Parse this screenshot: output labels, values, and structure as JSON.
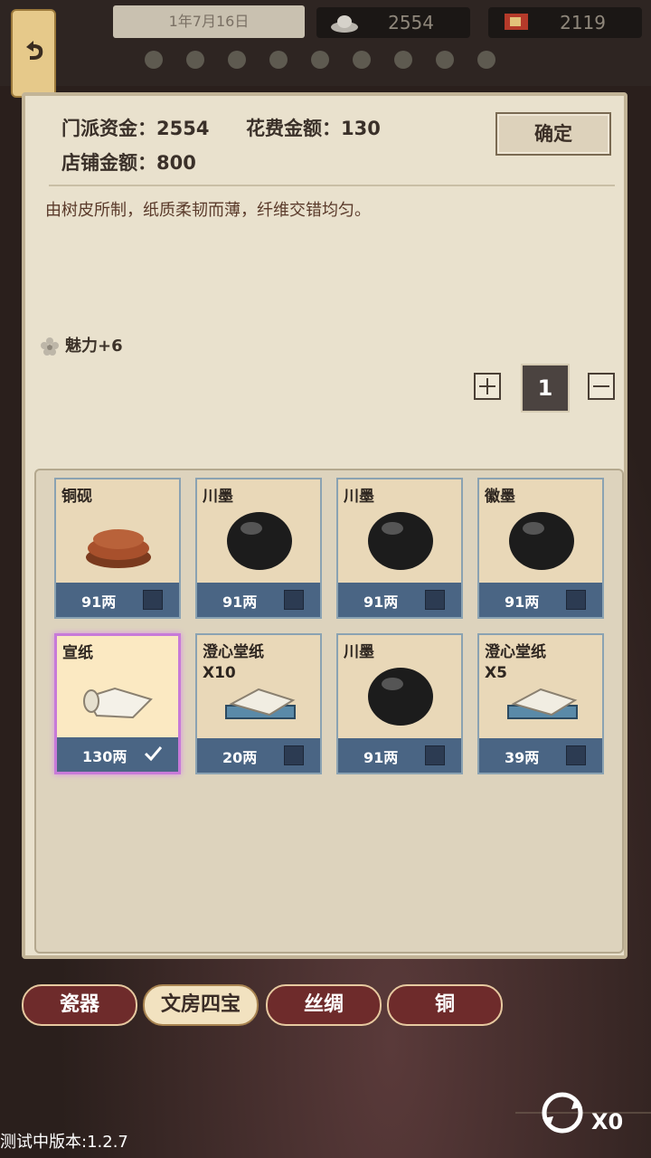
{
  "topbar": {
    "date": "1年7月16日",
    "silver": "2554",
    "flag": "2119"
  },
  "panel": {
    "fund_label": "门派资金：2554",
    "cost_label": "花费金额：130",
    "shop_label": "店铺金额：800",
    "confirm_label": "确定",
    "description": "由树皮所制，纸质柔韧而薄，纤维交错均匀。",
    "attribute": "魅力+6",
    "quantity": "1"
  },
  "items": [
    {
      "name": "铜砚",
      "count": "",
      "price": "91两",
      "icon": "inkstone-icon",
      "selected": false
    },
    {
      "name": "川墨",
      "count": "",
      "price": "91两",
      "icon": "ink-stick-icon",
      "selected": false
    },
    {
      "name": "川墨",
      "count": "",
      "price": "91两",
      "icon": "ink-stick-icon",
      "selected": false
    },
    {
      "name": "徽墨",
      "count": "",
      "price": "91两",
      "icon": "ink-stick-icon",
      "selected": false
    },
    {
      "name": "宣纸",
      "count": "",
      "price": "130两",
      "icon": "paper-scroll-icon",
      "selected": true
    },
    {
      "name": "澄心堂纸",
      "count": "X10",
      "price": "20两",
      "icon": "paper-bundle-icon",
      "selected": false
    },
    {
      "name": "川墨",
      "count": "",
      "price": "91两",
      "icon": "ink-stick-icon",
      "selected": false
    },
    {
      "name": "澄心堂纸",
      "count": "X5",
      "price": "39两",
      "icon": "paper-bundle-icon",
      "selected": false
    }
  ],
  "tabs": [
    "瓷器",
    "文房四宝",
    "丝绸",
    "铜"
  ],
  "active_tab": "文房四宝",
  "refresh_count": "X0",
  "version": "测试中版本:1.2.7"
}
